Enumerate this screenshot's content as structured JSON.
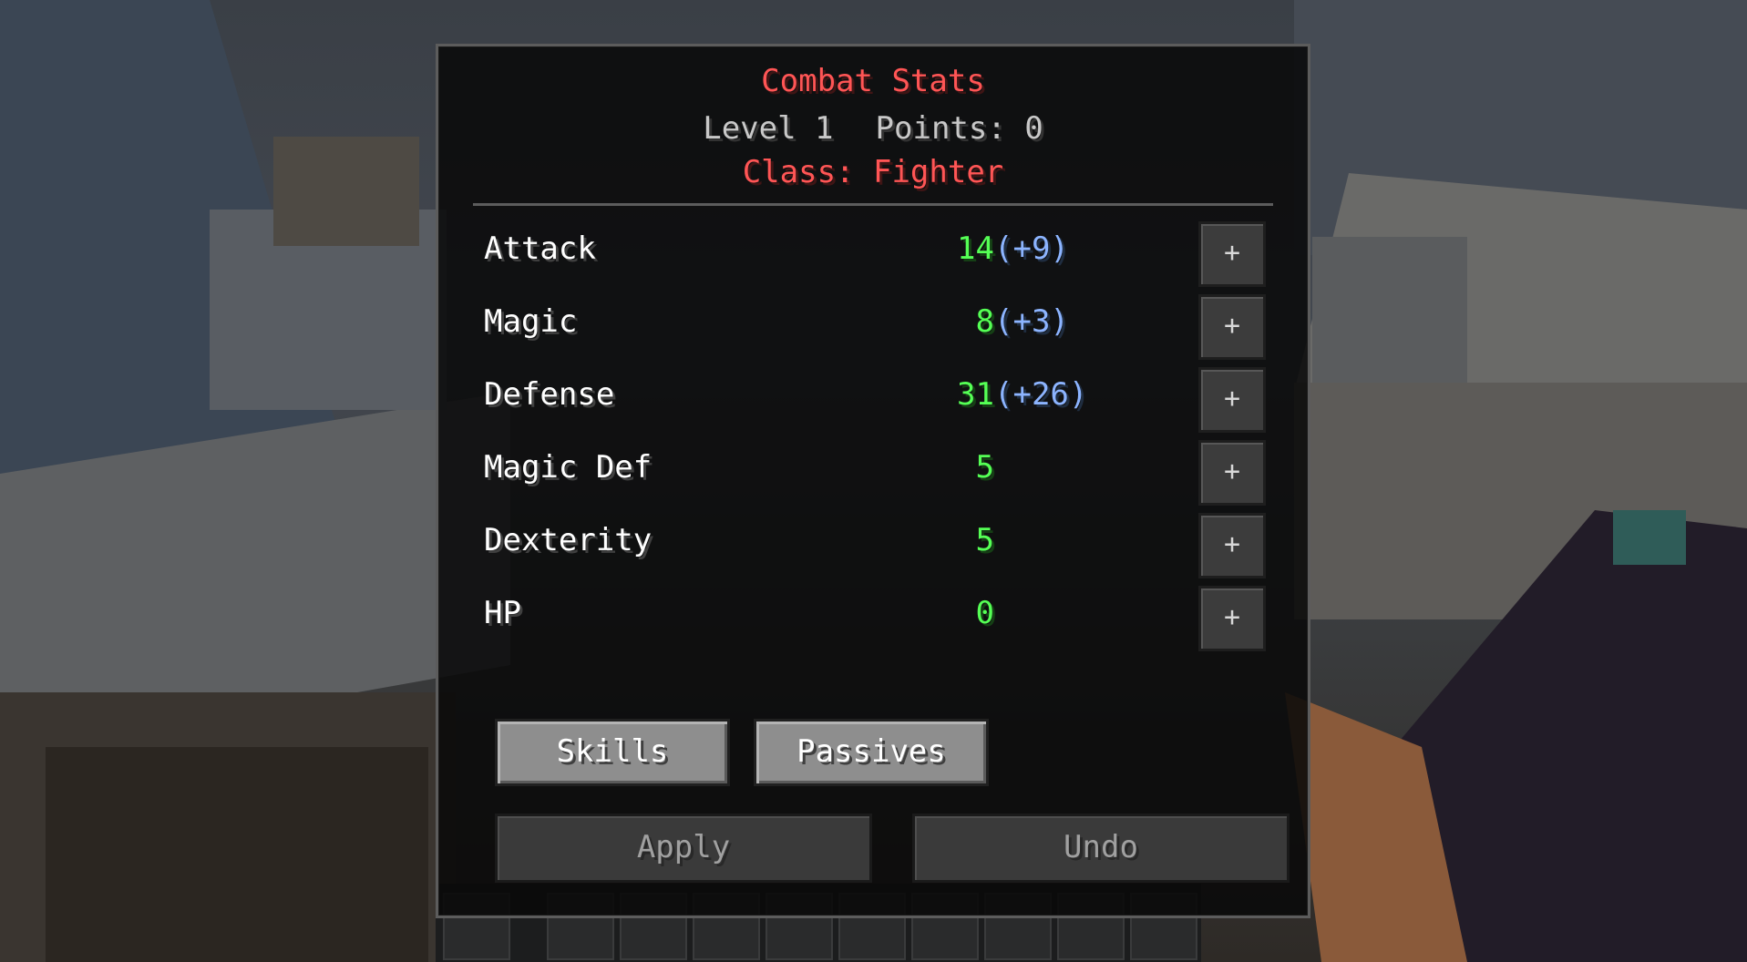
{
  "panel": {
    "title": "Combat Stats",
    "level_label": "Level 1",
    "points_label": "Points: 0",
    "class_label": "Class: Fighter"
  },
  "stats": [
    {
      "name": "Attack",
      "value": "14",
      "bonus": "(+9)",
      "plus": "+"
    },
    {
      "name": "Magic",
      "value": "8",
      "bonus": "(+3)",
      "plus": "+"
    },
    {
      "name": "Defense",
      "value": "31",
      "bonus": "(+26)",
      "plus": "+"
    },
    {
      "name": "Magic Def",
      "value": "5",
      "bonus": "",
      "plus": "+"
    },
    {
      "name": "Dexterity",
      "value": "5",
      "bonus": "",
      "plus": "+"
    },
    {
      "name": "HP",
      "value": "0",
      "bonus": "",
      "plus": "+"
    }
  ],
  "buttons": {
    "skills": "Skills",
    "passives": "Passives",
    "apply": "Apply",
    "undo": "Undo"
  },
  "colors": {
    "title": "#ff5555",
    "stat_value": "#55ff55",
    "stat_bonus": "#8cb4ff",
    "text": "#ffffff"
  }
}
